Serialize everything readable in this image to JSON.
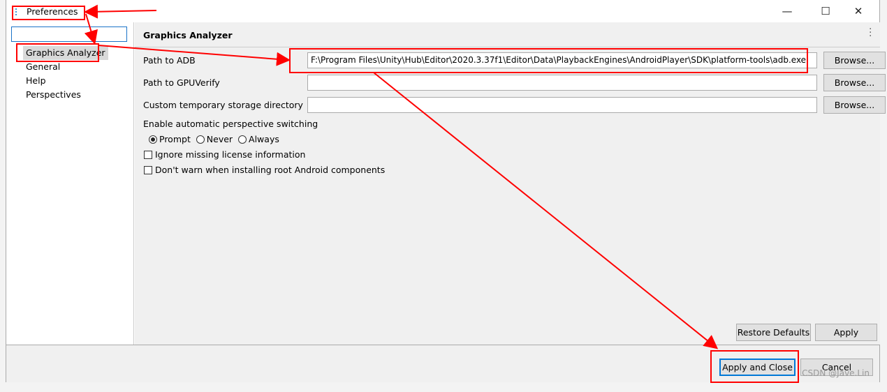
{
  "window": {
    "title": "Preferences",
    "controls": [
      "minimize",
      "maximize",
      "close"
    ]
  },
  "sidebar": {
    "filter_value": "",
    "items": [
      {
        "label": "Graphics Analyzer",
        "selected": true
      },
      {
        "label": "General"
      },
      {
        "label": "Help"
      },
      {
        "label": "Perspectives"
      }
    ]
  },
  "page": {
    "title": "Graphics Analyzer",
    "fields": [
      {
        "label": "Path to ADB",
        "value": "F:\\Program Files\\Unity\\Hub\\Editor\\2020.3.37f1\\Editor\\Data\\PlaybackEngines\\AndroidPlayer\\SDK\\platform-tools\\adb.exe",
        "button": "Browse..."
      },
      {
        "label": "Path to GPUVerify",
        "value": "",
        "button": "Browse..."
      },
      {
        "label": "Custom temporary storage directory",
        "value": "",
        "button": "Browse..."
      }
    ],
    "switching_label": "Enable automatic perspective switching",
    "radios": [
      {
        "label": "Prompt",
        "checked": true
      },
      {
        "label": "Never",
        "checked": false
      },
      {
        "label": "Always",
        "checked": false
      }
    ],
    "checkboxes": [
      {
        "label": "Ignore missing license information",
        "checked": false
      },
      {
        "label": "Don't warn when installing root Android components",
        "checked": false
      }
    ],
    "restore_defaults": "Restore Defaults",
    "apply": "Apply"
  },
  "footer": {
    "apply_close": "Apply and Close",
    "cancel": "Cancel"
  },
  "watermark": "CSDN @Jave.Lin",
  "annotation_color": "#ff0000"
}
